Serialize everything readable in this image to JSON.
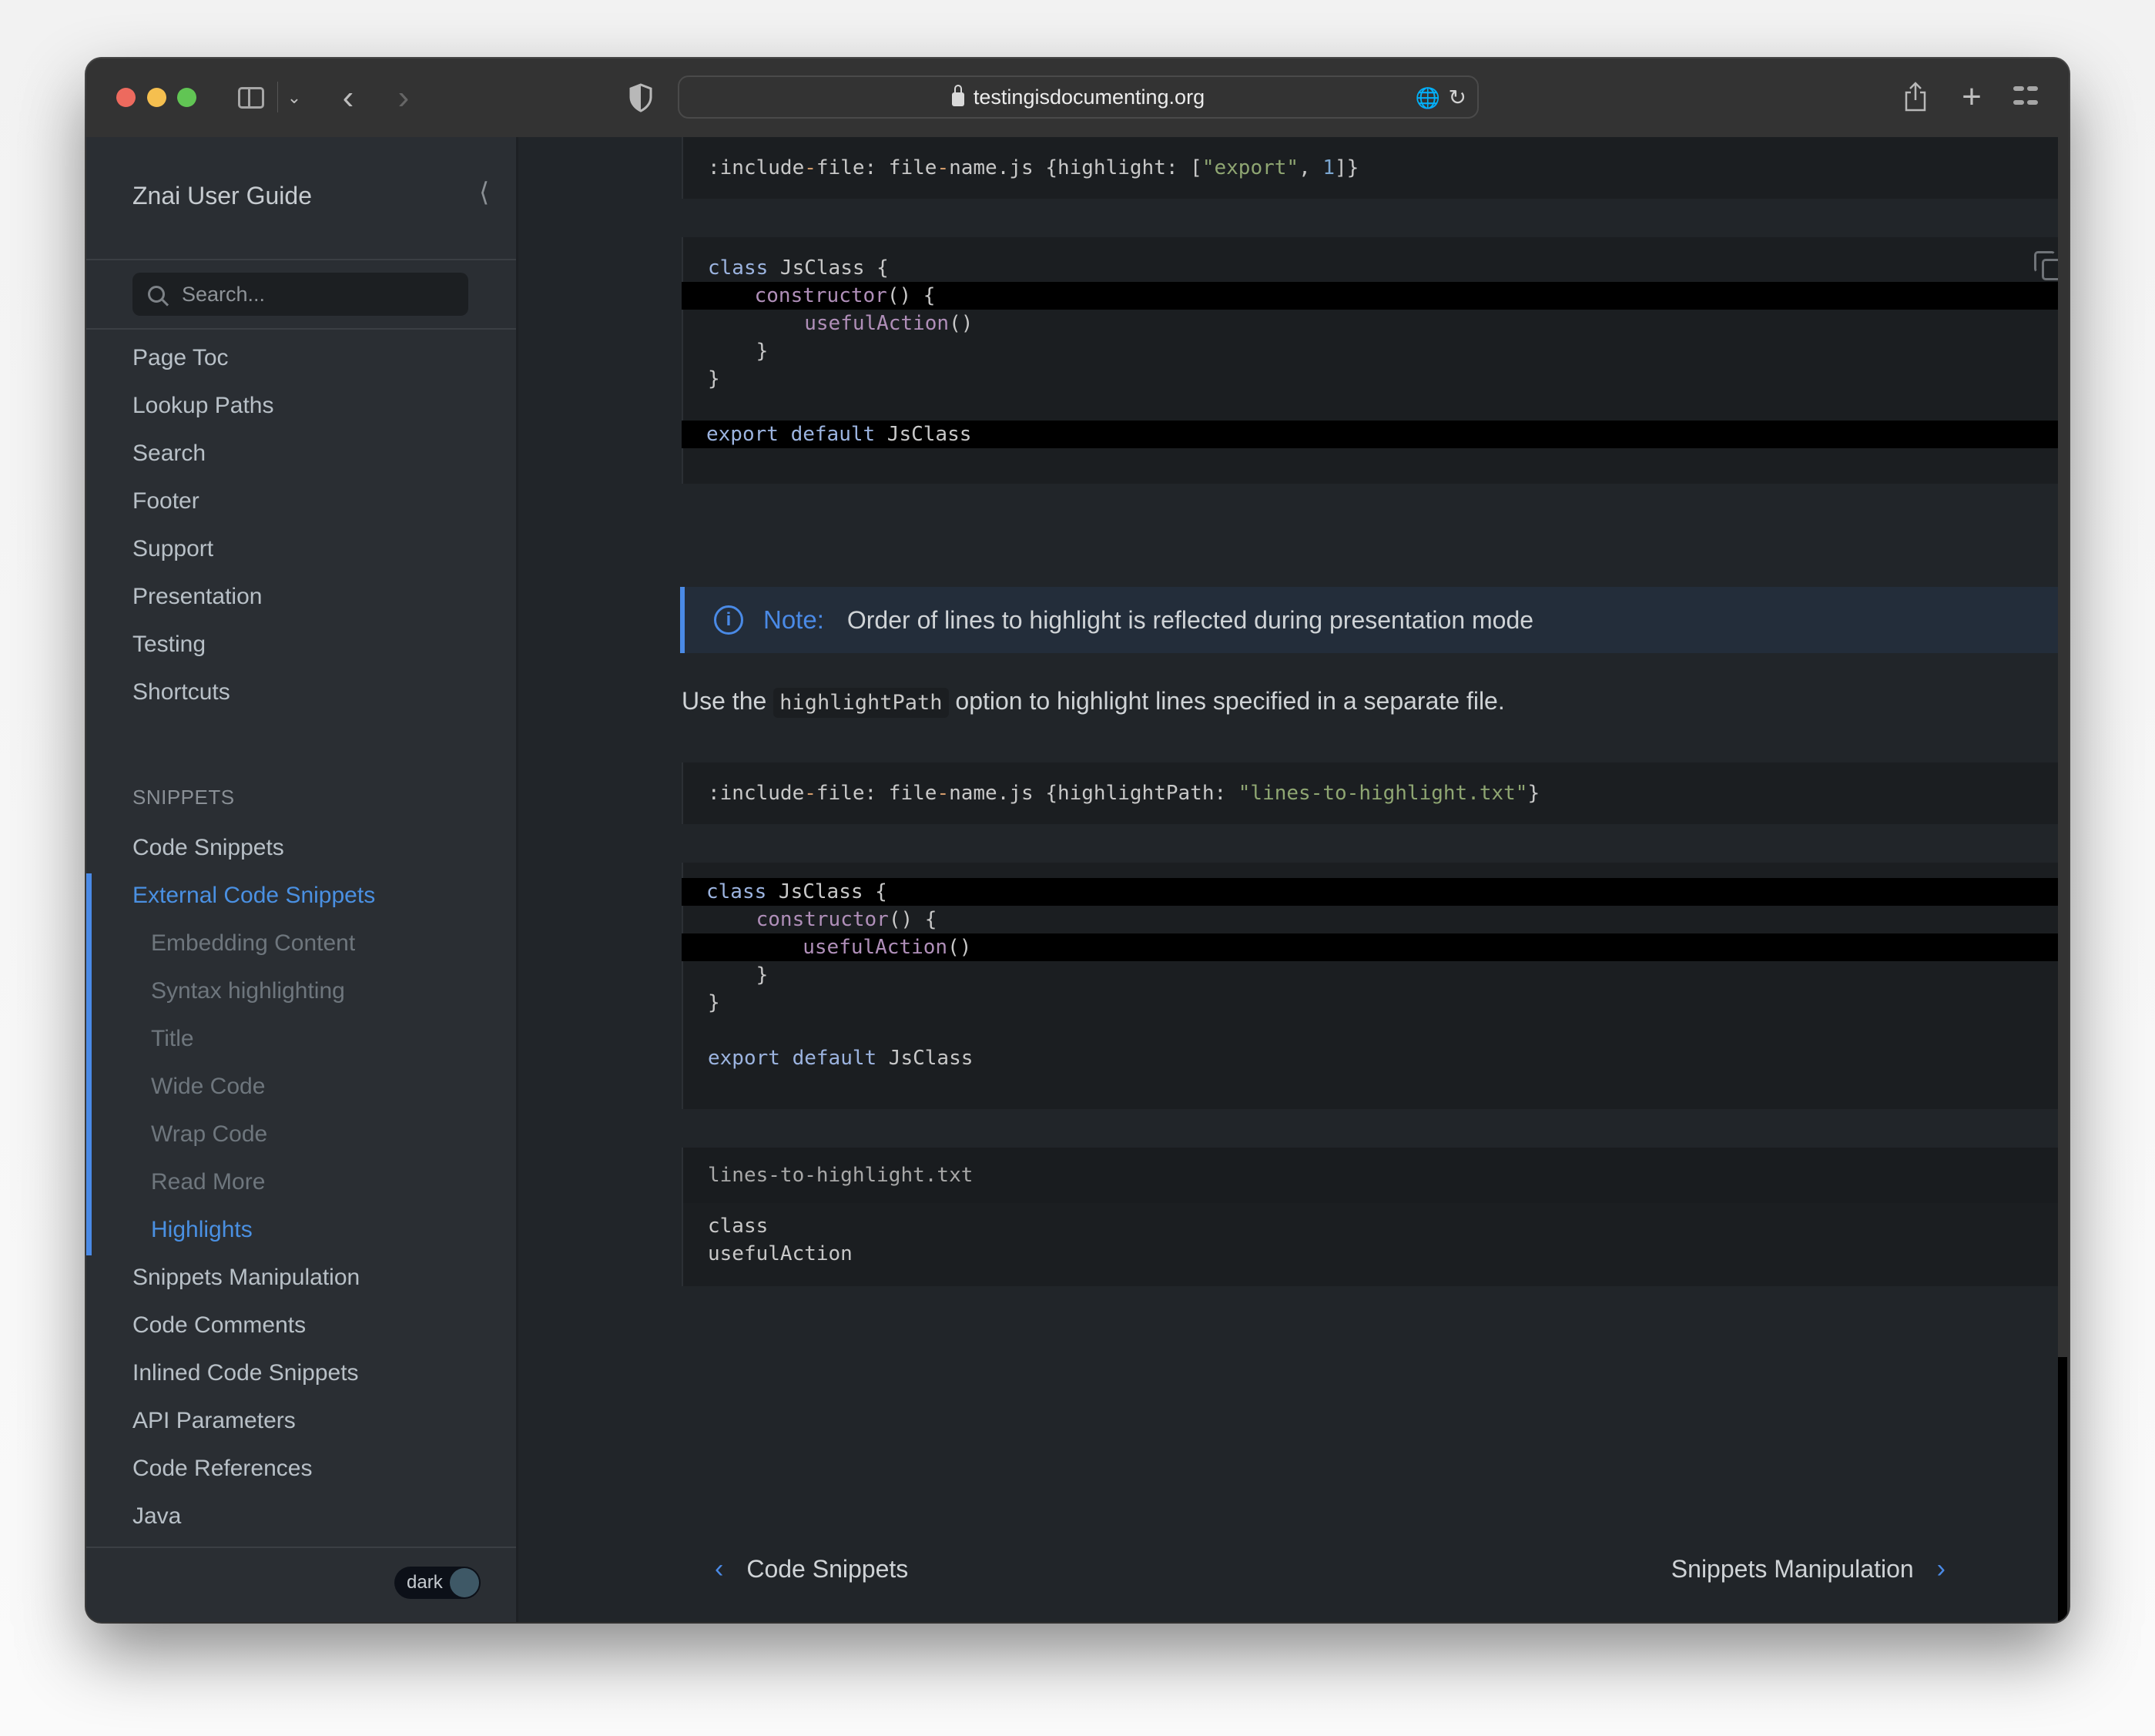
{
  "browser": {
    "url": "testingisdocumenting.org",
    "icons": {
      "sidebar_toggle": "sidebar-icon",
      "nav_back": "chevron-left-icon",
      "nav_forward": "chevron-right-icon",
      "privacy": "shield-icon",
      "lock": "lock-icon",
      "translate": "translate-icon",
      "reload": "reload-icon",
      "share": "share-icon",
      "new_tab": "plus-icon",
      "tab_overview": "grid-icon"
    }
  },
  "sidebar": {
    "title": "Znai User Guide",
    "search_placeholder": "Search...",
    "items_top": [
      "Page Toc",
      "Lookup Paths",
      "Search",
      "Footer",
      "Support",
      "Presentation",
      "Testing",
      "Shortcuts"
    ],
    "section_label": "SNIPPETS",
    "section_items": [
      {
        "label": "Code Snippets",
        "level": 0,
        "active": false
      },
      {
        "label": "External Code Snippets",
        "level": 0,
        "active": true
      },
      {
        "label": "Embedding Content",
        "level": 1,
        "active": false
      },
      {
        "label": "Syntax highlighting",
        "level": 1,
        "active": false
      },
      {
        "label": "Title",
        "level": 1,
        "active": false
      },
      {
        "label": "Wide Code",
        "level": 1,
        "active": false
      },
      {
        "label": "Wrap Code",
        "level": 1,
        "active": false
      },
      {
        "label": "Read More",
        "level": 1,
        "active": false
      },
      {
        "label": "Highlights",
        "level": 1,
        "active": true
      },
      {
        "label": "Snippets Manipulation",
        "level": 0,
        "active": false
      },
      {
        "label": "Code Comments",
        "level": 0,
        "active": false
      },
      {
        "label": "Inlined Code Snippets",
        "level": 0,
        "active": false
      },
      {
        "label": "API Parameters",
        "level": 0,
        "active": false
      },
      {
        "label": "Code References",
        "level": 0,
        "active": false
      },
      {
        "label": "Java",
        "level": 0,
        "active": false
      }
    ],
    "theme_toggle_label": "dark",
    "accent_color": "#4a8ae6"
  },
  "content": {
    "snippet1_cmd": [
      ":include",
      "-",
      "file: file",
      "-",
      "name.js {highlight: [",
      "\"export\"",
      ", ",
      "1",
      "]}"
    ],
    "code1": {
      "lines": [
        {
          "tokens": [
            [
              "kw",
              "class"
            ],
            [
              "",
              " JsClass {"
            ]
          ],
          "highlight": false
        },
        {
          "tokens": [
            [
              "",
              "    "
            ],
            [
              "fn",
              "constructor"
            ],
            [
              "",
              "() {"
            ]
          ],
          "highlight": true
        },
        {
          "tokens": [
            [
              "",
              "        "
            ],
            [
              "fn",
              "usefulAction"
            ],
            [
              "",
              "()"
            ]
          ],
          "highlight": false
        },
        {
          "tokens": [
            [
              "",
              "    }"
            ]
          ],
          "highlight": false
        },
        {
          "tokens": [
            [
              "",
              "}"
            ]
          ],
          "highlight": false
        },
        {
          "tokens": [
            [
              "",
              ""
            ]
          ],
          "highlight": false
        },
        {
          "tokens": [
            [
              "kw",
              "export"
            ],
            [
              "",
              " "
            ],
            [
              "kw",
              "default"
            ],
            [
              "",
              " JsClass"
            ]
          ],
          "highlight": true
        }
      ]
    },
    "note": {
      "label": "Note:",
      "text": "Order of lines to highlight is reflected during presentation mode"
    },
    "paragraph": {
      "before": "Use the ",
      "code": "highlightPath",
      "after": " option to highlight lines specified in a separate file."
    },
    "snippet2_cmd": [
      ":include",
      "-",
      "file: file",
      "-",
      "name.js {highlightPath: ",
      "\"lines-to-highlight.txt\"",
      "}"
    ],
    "code2": {
      "lines": [
        {
          "tokens": [
            [
              "kw",
              "class"
            ],
            [
              "",
              " JsClass {"
            ]
          ],
          "highlight": true
        },
        {
          "tokens": [
            [
              "",
              "    "
            ],
            [
              "fn",
              "constructor"
            ],
            [
              "",
              "() {"
            ]
          ],
          "highlight": false
        },
        {
          "tokens": [
            [
              "",
              "        "
            ],
            [
              "fn",
              "usefulAction"
            ],
            [
              "",
              "()"
            ]
          ],
          "highlight": true
        },
        {
          "tokens": [
            [
              "",
              "    }"
            ]
          ],
          "highlight": false
        },
        {
          "tokens": [
            [
              "",
              "}"
            ]
          ],
          "highlight": false
        },
        {
          "tokens": [
            [
              "",
              ""
            ]
          ],
          "highlight": false
        },
        {
          "tokens": [
            [
              "kw",
              "export"
            ],
            [
              "",
              " "
            ],
            [
              "kw",
              "default"
            ],
            [
              "",
              " JsClass"
            ]
          ],
          "highlight": false
        }
      ]
    },
    "file_title": "lines-to-highlight.txt",
    "file_lines": [
      "class",
      "usefulAction"
    ],
    "pager": {
      "prev": "Code Snippets",
      "next": "Snippets Manipulation"
    }
  }
}
